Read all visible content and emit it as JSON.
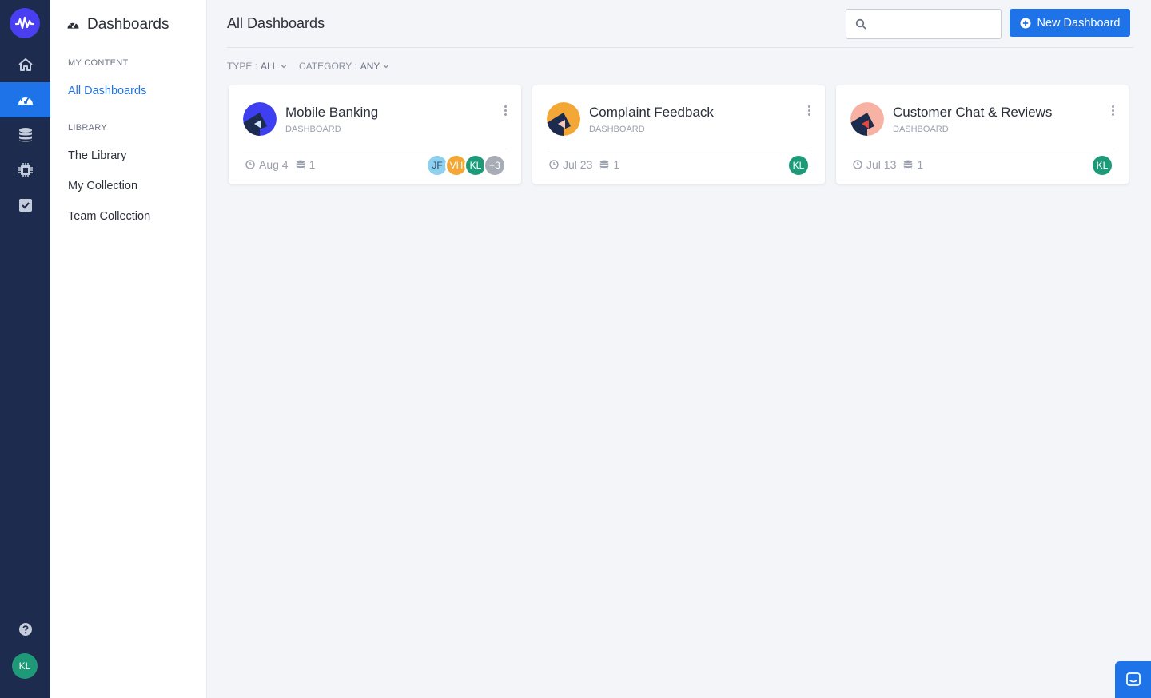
{
  "sidebar": {
    "title": "Dashboards",
    "sections": [
      {
        "label": "MY CONTENT",
        "items": [
          {
            "label": "All Dashboards"
          }
        ]
      },
      {
        "label": "LIBRARY",
        "items": [
          {
            "label": "The Library"
          },
          {
            "label": "My Collection"
          },
          {
            "label": "Team Collection"
          }
        ]
      }
    ]
  },
  "rail": {
    "user_initials": "KL",
    "icons": [
      "home-icon",
      "dashboard-gauge-icon",
      "database-icon",
      "chip-icon",
      "checklist-icon",
      "help-icon"
    ]
  },
  "header": {
    "title": "All Dashboards",
    "search_placeholder": "",
    "new_button_label": "New Dashboard"
  },
  "filters": {
    "type_label": "TYPE :",
    "type_value": "ALL",
    "category_label": "CATEGORY :",
    "category_value": "ANY"
  },
  "cards": [
    {
      "name": "Mobile Banking",
      "kind": "DASHBOARD",
      "date": "Aug 4",
      "sources": "1",
      "badge_color": "#3e3ff0",
      "people": [
        {
          "initials": "JF",
          "color": "#8fd0ee"
        },
        {
          "initials": "VH",
          "color": "#f2a736"
        },
        {
          "initials": "KL",
          "color": "#1e9a78"
        },
        {
          "initials": "+3",
          "color": "#a8acb6"
        }
      ]
    },
    {
      "name": "Complaint Feedback",
      "kind": "DASHBOARD",
      "date": "Jul 23",
      "sources": "1",
      "badge_color": "#f2a736",
      "people": [
        {
          "initials": "KL",
          "color": "#1e9a78"
        }
      ]
    },
    {
      "name": "Customer Chat & Reviews",
      "kind": "DASHBOARD",
      "date": "Jul 13",
      "sources": "1",
      "badge_color": "#f7b2a4",
      "people": [
        {
          "initials": "KL",
          "color": "#1e9a78"
        }
      ]
    }
  ],
  "colors": {
    "accent": "#1e73e8",
    "rail": "#1d2b4e"
  }
}
